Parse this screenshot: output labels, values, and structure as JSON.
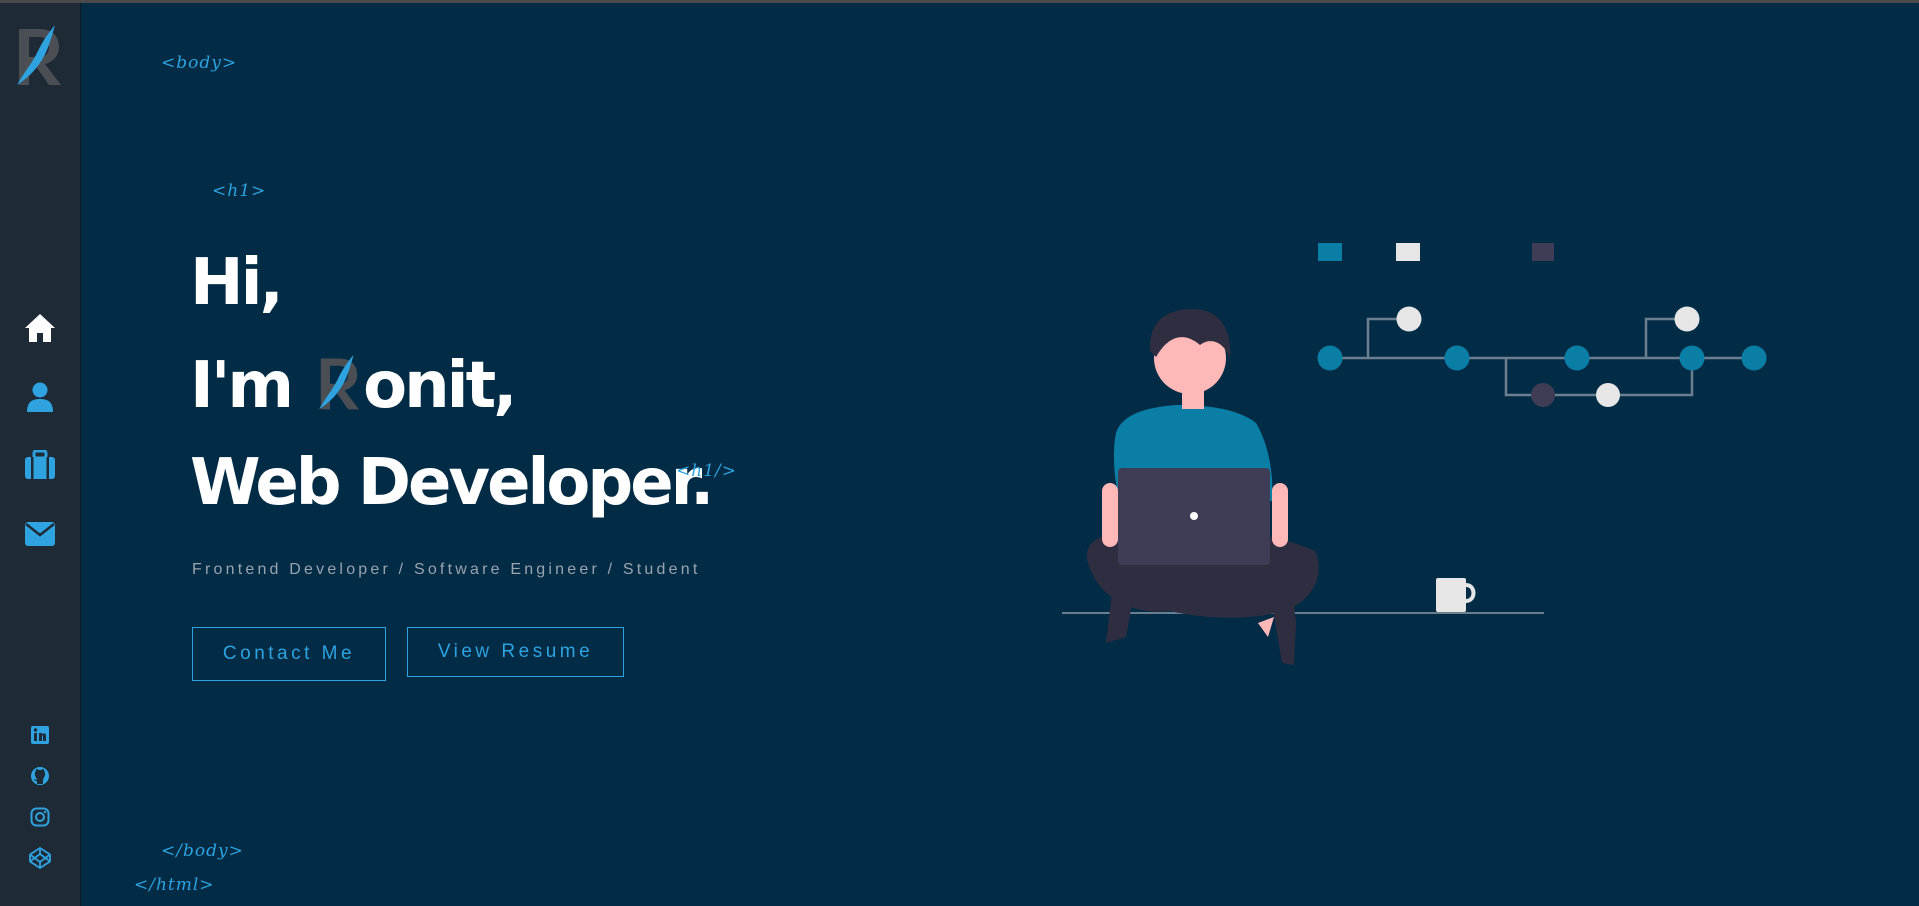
{
  "sidebar": {
    "nav": [
      {
        "name": "home",
        "icon": "home-icon"
      },
      {
        "name": "about",
        "icon": "user-icon"
      },
      {
        "name": "portfolio",
        "icon": "briefcase-icon"
      },
      {
        "name": "contact",
        "icon": "envelope-icon"
      }
    ],
    "social": [
      {
        "name": "linkedin",
        "icon": "linkedin-icon"
      },
      {
        "name": "github",
        "icon": "github-icon"
      },
      {
        "name": "instagram",
        "icon": "instagram-icon"
      },
      {
        "name": "codepen",
        "icon": "codepen-icon"
      }
    ]
  },
  "tags": {
    "body_open": "<body>",
    "h1_open": "<h1>",
    "h1_close": "<h1/>",
    "body_close": "</body>",
    "html_close": "</html>"
  },
  "hero": {
    "line1": "Hi,",
    "line2_prefix": "I'm",
    "line2_suffix": "onit,",
    "line3": "Web Developer.",
    "subtitle": "Frontend Developer / Software Engineer / Student"
  },
  "buttons": {
    "contact": "Contact Me",
    "resume": "View Resume"
  },
  "colors": {
    "background": "#022b46",
    "sidebar": "#1f2a37",
    "accent": "#2ea3df",
    "teal": "#0a7ea4"
  }
}
